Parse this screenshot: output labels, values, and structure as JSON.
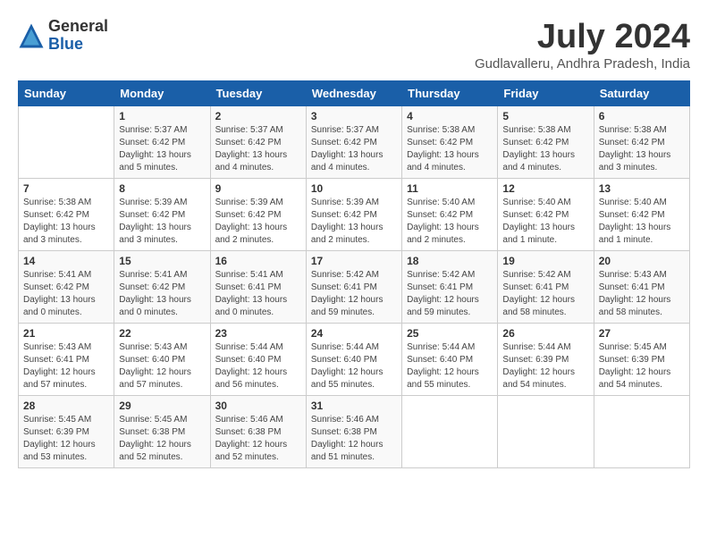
{
  "logo": {
    "general": "General",
    "blue": "Blue"
  },
  "title": "July 2024",
  "location": "Gudlavalleru, Andhra Pradesh, India",
  "days_of_week": [
    "Sunday",
    "Monday",
    "Tuesday",
    "Wednesday",
    "Thursday",
    "Friday",
    "Saturday"
  ],
  "weeks": [
    [
      {
        "day": null,
        "info": ""
      },
      {
        "day": "1",
        "info": "Sunrise: 5:37 AM\nSunset: 6:42 PM\nDaylight: 13 hours\nand 5 minutes."
      },
      {
        "day": "2",
        "info": "Sunrise: 5:37 AM\nSunset: 6:42 PM\nDaylight: 13 hours\nand 4 minutes."
      },
      {
        "day": "3",
        "info": "Sunrise: 5:37 AM\nSunset: 6:42 PM\nDaylight: 13 hours\nand 4 minutes."
      },
      {
        "day": "4",
        "info": "Sunrise: 5:38 AM\nSunset: 6:42 PM\nDaylight: 13 hours\nand 4 minutes."
      },
      {
        "day": "5",
        "info": "Sunrise: 5:38 AM\nSunset: 6:42 PM\nDaylight: 13 hours\nand 4 minutes."
      },
      {
        "day": "6",
        "info": "Sunrise: 5:38 AM\nSunset: 6:42 PM\nDaylight: 13 hours\nand 3 minutes."
      }
    ],
    [
      {
        "day": "7",
        "info": "Sunrise: 5:38 AM\nSunset: 6:42 PM\nDaylight: 13 hours\nand 3 minutes."
      },
      {
        "day": "8",
        "info": "Sunrise: 5:39 AM\nSunset: 6:42 PM\nDaylight: 13 hours\nand 3 minutes."
      },
      {
        "day": "9",
        "info": "Sunrise: 5:39 AM\nSunset: 6:42 PM\nDaylight: 13 hours\nand 2 minutes."
      },
      {
        "day": "10",
        "info": "Sunrise: 5:39 AM\nSunset: 6:42 PM\nDaylight: 13 hours\nand 2 minutes."
      },
      {
        "day": "11",
        "info": "Sunrise: 5:40 AM\nSunset: 6:42 PM\nDaylight: 13 hours\nand 2 minutes."
      },
      {
        "day": "12",
        "info": "Sunrise: 5:40 AM\nSunset: 6:42 PM\nDaylight: 13 hours\nand 1 minute."
      },
      {
        "day": "13",
        "info": "Sunrise: 5:40 AM\nSunset: 6:42 PM\nDaylight: 13 hours\nand 1 minute."
      }
    ],
    [
      {
        "day": "14",
        "info": "Sunrise: 5:41 AM\nSunset: 6:42 PM\nDaylight: 13 hours\nand 0 minutes."
      },
      {
        "day": "15",
        "info": "Sunrise: 5:41 AM\nSunset: 6:42 PM\nDaylight: 13 hours\nand 0 minutes."
      },
      {
        "day": "16",
        "info": "Sunrise: 5:41 AM\nSunset: 6:41 PM\nDaylight: 13 hours\nand 0 minutes."
      },
      {
        "day": "17",
        "info": "Sunrise: 5:42 AM\nSunset: 6:41 PM\nDaylight: 12 hours\nand 59 minutes."
      },
      {
        "day": "18",
        "info": "Sunrise: 5:42 AM\nSunset: 6:41 PM\nDaylight: 12 hours\nand 59 minutes."
      },
      {
        "day": "19",
        "info": "Sunrise: 5:42 AM\nSunset: 6:41 PM\nDaylight: 12 hours\nand 58 minutes."
      },
      {
        "day": "20",
        "info": "Sunrise: 5:43 AM\nSunset: 6:41 PM\nDaylight: 12 hours\nand 58 minutes."
      }
    ],
    [
      {
        "day": "21",
        "info": "Sunrise: 5:43 AM\nSunset: 6:41 PM\nDaylight: 12 hours\nand 57 minutes."
      },
      {
        "day": "22",
        "info": "Sunrise: 5:43 AM\nSunset: 6:40 PM\nDaylight: 12 hours\nand 57 minutes."
      },
      {
        "day": "23",
        "info": "Sunrise: 5:44 AM\nSunset: 6:40 PM\nDaylight: 12 hours\nand 56 minutes."
      },
      {
        "day": "24",
        "info": "Sunrise: 5:44 AM\nSunset: 6:40 PM\nDaylight: 12 hours\nand 55 minutes."
      },
      {
        "day": "25",
        "info": "Sunrise: 5:44 AM\nSunset: 6:40 PM\nDaylight: 12 hours\nand 55 minutes."
      },
      {
        "day": "26",
        "info": "Sunrise: 5:44 AM\nSunset: 6:39 PM\nDaylight: 12 hours\nand 54 minutes."
      },
      {
        "day": "27",
        "info": "Sunrise: 5:45 AM\nSunset: 6:39 PM\nDaylight: 12 hours\nand 54 minutes."
      }
    ],
    [
      {
        "day": "28",
        "info": "Sunrise: 5:45 AM\nSunset: 6:39 PM\nDaylight: 12 hours\nand 53 minutes."
      },
      {
        "day": "29",
        "info": "Sunrise: 5:45 AM\nSunset: 6:38 PM\nDaylight: 12 hours\nand 52 minutes."
      },
      {
        "day": "30",
        "info": "Sunrise: 5:46 AM\nSunset: 6:38 PM\nDaylight: 12 hours\nand 52 minutes."
      },
      {
        "day": "31",
        "info": "Sunrise: 5:46 AM\nSunset: 6:38 PM\nDaylight: 12 hours\nand 51 minutes."
      },
      {
        "day": null,
        "info": ""
      },
      {
        "day": null,
        "info": ""
      },
      {
        "day": null,
        "info": ""
      }
    ]
  ]
}
